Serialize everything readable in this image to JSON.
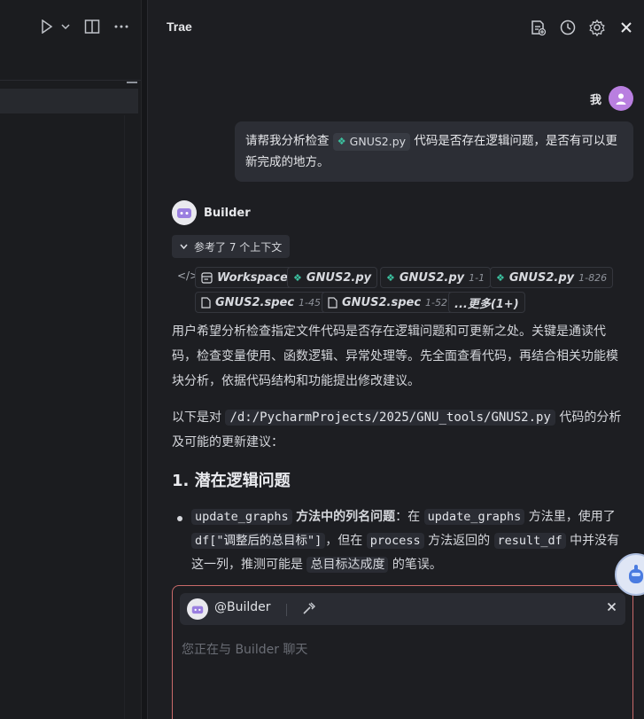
{
  "editor": {
    "run_icon": "play-icon",
    "dropdown_icon": "chevron-down-icon",
    "split_icon": "split-editor-icon",
    "more_icon": "more-icon"
  },
  "panel": {
    "title": "Trae",
    "header_icons": [
      "new-chat-icon",
      "history-icon",
      "settings-icon",
      "close-icon"
    ]
  },
  "user_message": {
    "name": "我",
    "text_before": "请帮我分析检查",
    "file_chip": "GNUS2.py",
    "text_after": "代码是否存在逻辑问题，是否有可以更新完成的地方。"
  },
  "bot": {
    "name": "Builder",
    "context_toggle": "参考了 7 个上下文",
    "context_items": [
      {
        "label": "Workspace",
        "icon": "workspace-icon",
        "range": ""
      },
      {
        "label": "GNUS2.py",
        "icon": "python-file-icon",
        "range": ""
      },
      {
        "label": "GNUS2.py",
        "icon": "python-file-icon",
        "range": "1-1"
      },
      {
        "label": "GNUS2.py",
        "icon": "python-file-icon",
        "range": "1-826"
      },
      {
        "label": "GNUS2.spec",
        "icon": "file-icon",
        "range": "1-45"
      },
      {
        "label": "GNUS2.spec",
        "icon": "file-icon",
        "range": "1-52"
      },
      {
        "label": "...更多(1+)",
        "icon": "",
        "range": ""
      }
    ],
    "para1": "用户希望分析检查指定文件代码是否存在逻辑问题和可更新之处。关键是通读代码，检查变量使用、函数逻辑、异常处理等。先全面查看代码，再结合相关功能模块分析，依据代码结构和功能提出修改建议。",
    "para2_before": "以下是对",
    "para2_path": "/d:/PycharmProjects/2025/GNU_tools/GNUS2.py",
    "para2_after": "代码的分析及可能的更新建议：",
    "heading": "1. 潜在逻辑问题",
    "bullet": {
      "code1": "update_graphs",
      "bold": "方法中的列名问题",
      "t1": "：在",
      "code2": "update_graphs",
      "t2": "方法里，使用了",
      "code3": "df[\"调整后的总目标\"]",
      "t3": "，但在",
      "code4": "process",
      "t4": "方法返回的",
      "code5": "result_df",
      "t5": "中并没有这一列，推测可能是",
      "tag": "总目标达成度",
      "t6": "的笔误。"
    }
  },
  "composer": {
    "agent": "@Builder",
    "placeholder": "您正在与 Builder 聊天"
  }
}
